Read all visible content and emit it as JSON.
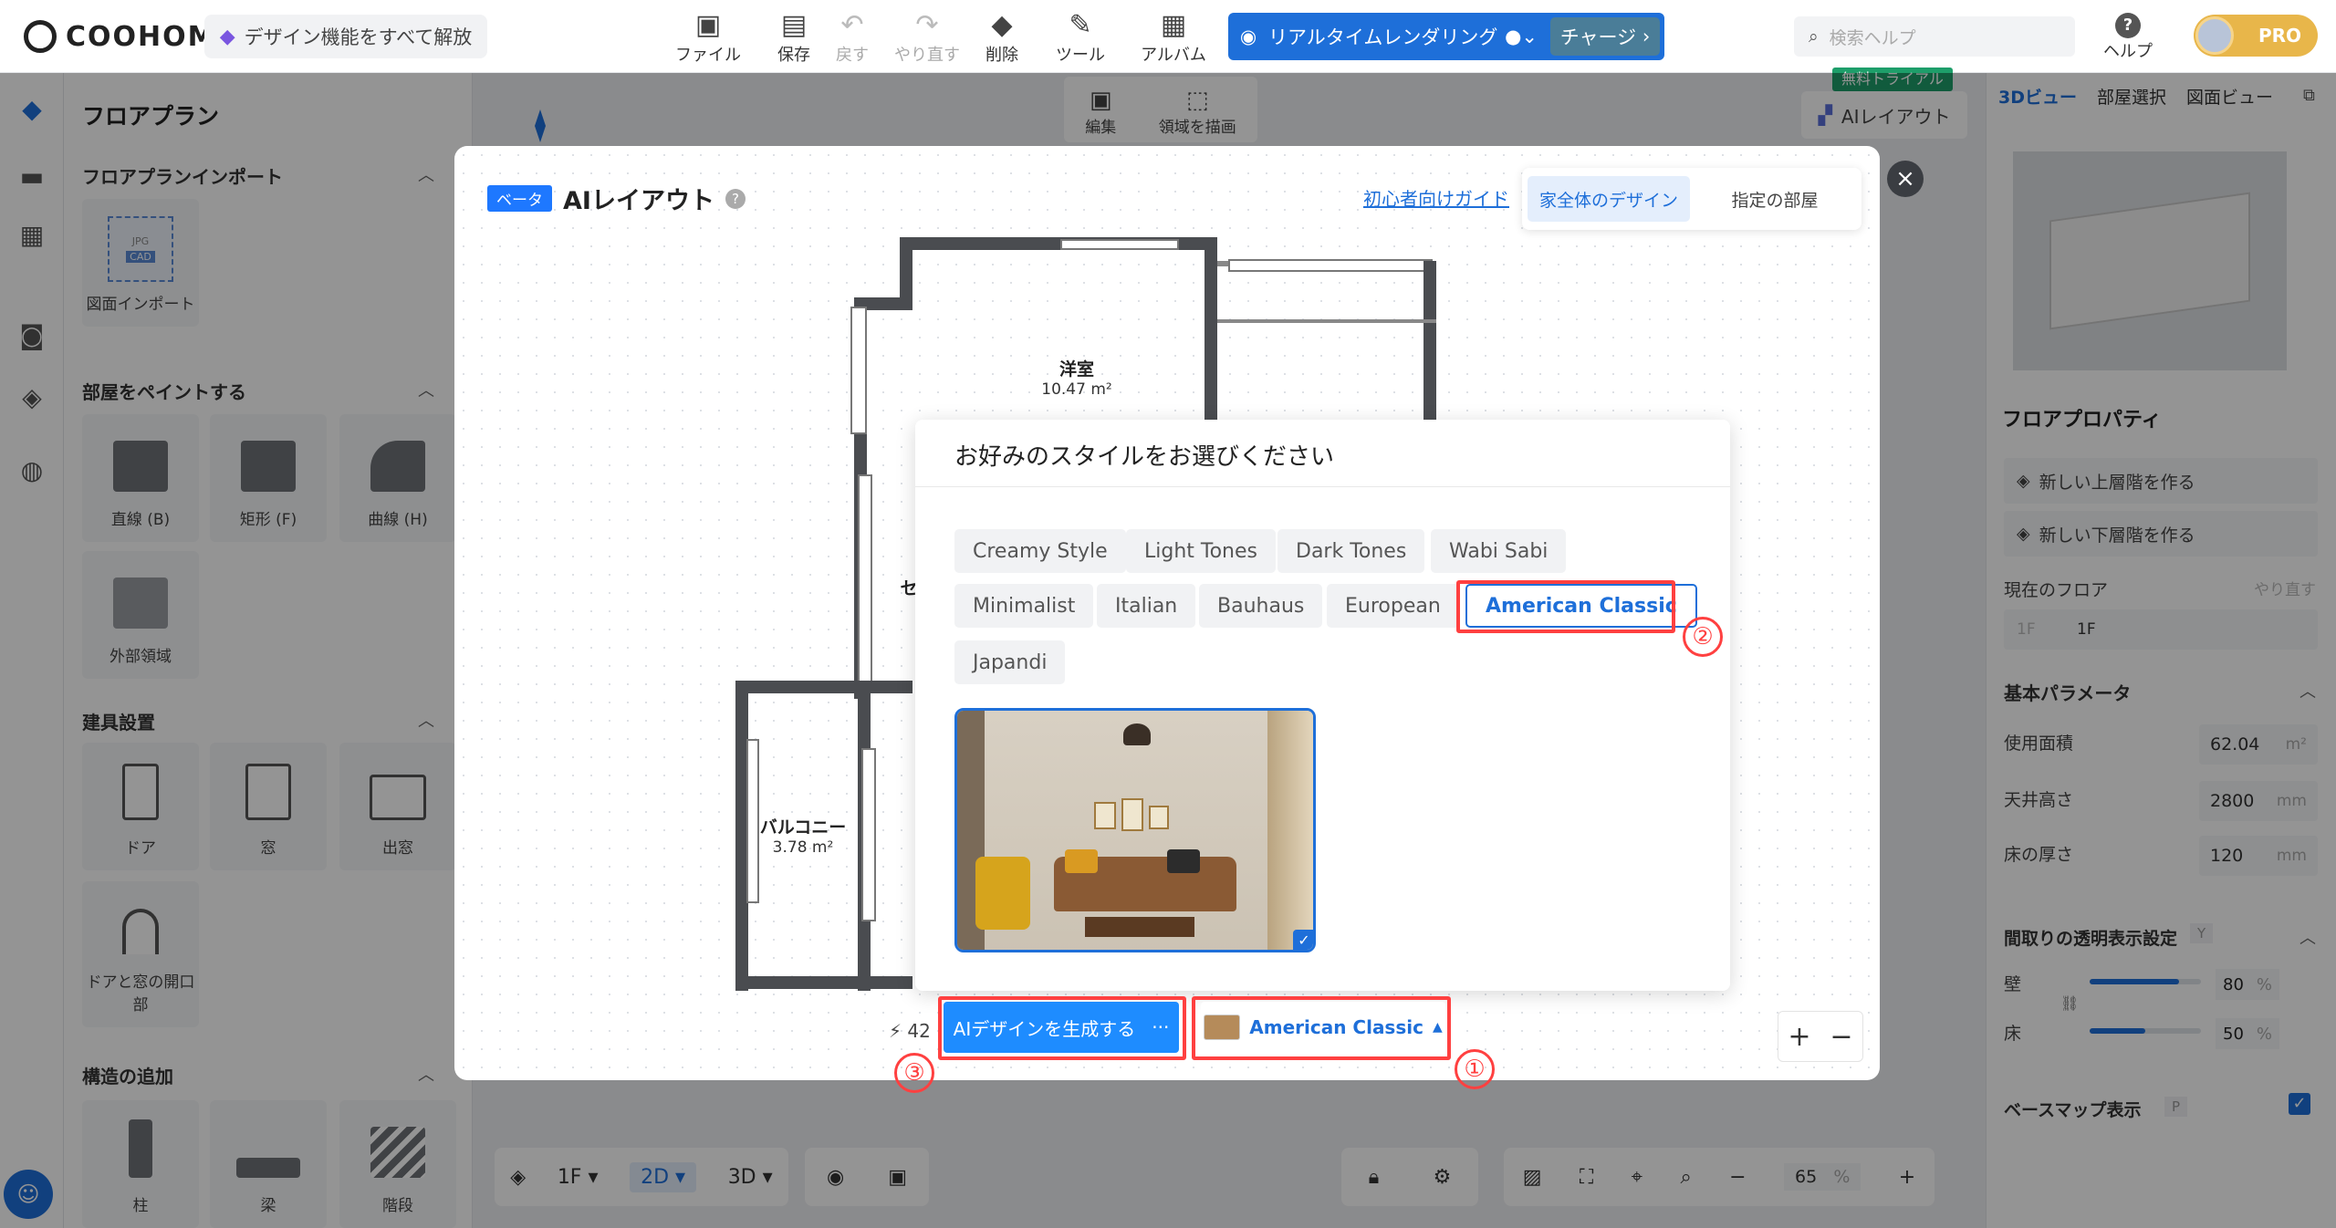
{
  "topbar": {
    "logo": "COOHOM",
    "unlock_label": "デザイン機能をすべて解放",
    "tools": [
      {
        "label": "ファイル",
        "icon": "file-icon",
        "disabled": false
      },
      {
        "label": "保存",
        "icon": "save-icon",
        "disabled": false
      },
      {
        "label": "戻す",
        "icon": "undo-icon",
        "disabled": true
      },
      {
        "label": "やり直す",
        "icon": "redo-icon",
        "disabled": true
      },
      {
        "label": "削除",
        "icon": "eraser-icon",
        "disabled": false
      },
      {
        "label": "ツール",
        "icon": "wrench-icon",
        "disabled": false
      },
      {
        "label": "アルバム",
        "icon": "album-icon",
        "disabled": false
      }
    ],
    "render_label": "リアルタイムレンダリング",
    "charge_label": "チャージ",
    "search_placeholder": "検索ヘルプ",
    "help_label": "ヘルプ",
    "pro_label": "PRO"
  },
  "subtoolbar": {
    "edit_label": "編集",
    "draw_area_label": "領域を描画",
    "trial_badge": "無料トライアル",
    "ai_layout_label": "AIレイアウト"
  },
  "left_panel": {
    "title": "フロアプラン",
    "sections": {
      "import": {
        "title": "フロアプランインポート",
        "items": [
          "図面インポート"
        ],
        "badges": [
          "JPG",
          "CAD"
        ]
      },
      "paint": {
        "title": "部屋をペイントする",
        "items": [
          "直線 (B)",
          "矩形 (F)",
          "曲線 (H)",
          "外部領域"
        ]
      },
      "fixtures": {
        "title": "建具設置",
        "items": [
          "ドア",
          "窓",
          "出窓",
          "ドアと窓の開口部"
        ]
      },
      "structure": {
        "title": "構造の追加",
        "items": [
          "柱",
          "梁",
          "階段"
        ]
      }
    }
  },
  "bottom_bar": {
    "floor": "1F",
    "view_2d": "2D",
    "view_3d": "3D",
    "zoom_value": "65",
    "zoom_unit": "%"
  },
  "right_panel": {
    "tabs": [
      "3Dビュー",
      "部屋選択",
      "図面ビュー"
    ],
    "floor_props_title": "フロアプロパティ",
    "new_upper": "新しい上層階を作る",
    "new_lower": "新しい下層階を作る",
    "current_floor_label": "現在のフロア",
    "redo_label": "やり直す",
    "floor_prefix": "1F",
    "floor_value": "1F",
    "basic_params_title": "基本パラメータ",
    "usable_area_label": "使用面積",
    "usable_area_value": "62.04",
    "usable_area_unit": "m²",
    "ceiling_label": "天井高さ",
    "ceiling_value": "2800",
    "ceiling_unit": "mm",
    "floor_thickness_label": "床の厚さ",
    "floor_thickness_value": "120",
    "floor_thickness_unit": "mm",
    "transparency_title": "間取りの透明表示設定",
    "transparency_key": "Y",
    "wall_label": "壁",
    "wall_value": "80",
    "wall_level": 0.8,
    "floor_label": "床",
    "floor_tr_value": "50",
    "floor_tr_level": 0.5,
    "percent": "%",
    "basemap_label": "ベースマップ表示",
    "basemap_key": "P",
    "basemap_checked": true
  },
  "modal": {
    "beta_label": "ベータ",
    "title": "AIレイアウト",
    "guide_link": "初心者向けガイド",
    "segments": [
      "家全体のデザイン",
      "指定の部屋"
    ],
    "active_segment": 0,
    "rooms": [
      {
        "name": "洋室",
        "area": "10.47 m²"
      },
      {
        "name": "バルコニー",
        "area": "3.78 m²"
      },
      {
        "name": "セ",
        "area": ""
      }
    ],
    "popover_title": "お好みのスタイルをお選びください",
    "styles": [
      "Creamy Style",
      "Light Tones",
      "Dark Tones",
      "Wabi Sabi",
      "Minimalist",
      "Italian",
      "Bauhaus",
      "European",
      "American Classic",
      "Japandi"
    ],
    "selected_style": "American Classic",
    "credits": "42",
    "generate_label": "AIデザインを生成する",
    "more_label": "···",
    "style_select_label": "American Classic",
    "annotations": [
      "①",
      "②",
      "③"
    ]
  },
  "colors": {
    "accent": "#1e6fd9",
    "annotation": "#ff4040",
    "button_blue": "#1e8cff"
  }
}
